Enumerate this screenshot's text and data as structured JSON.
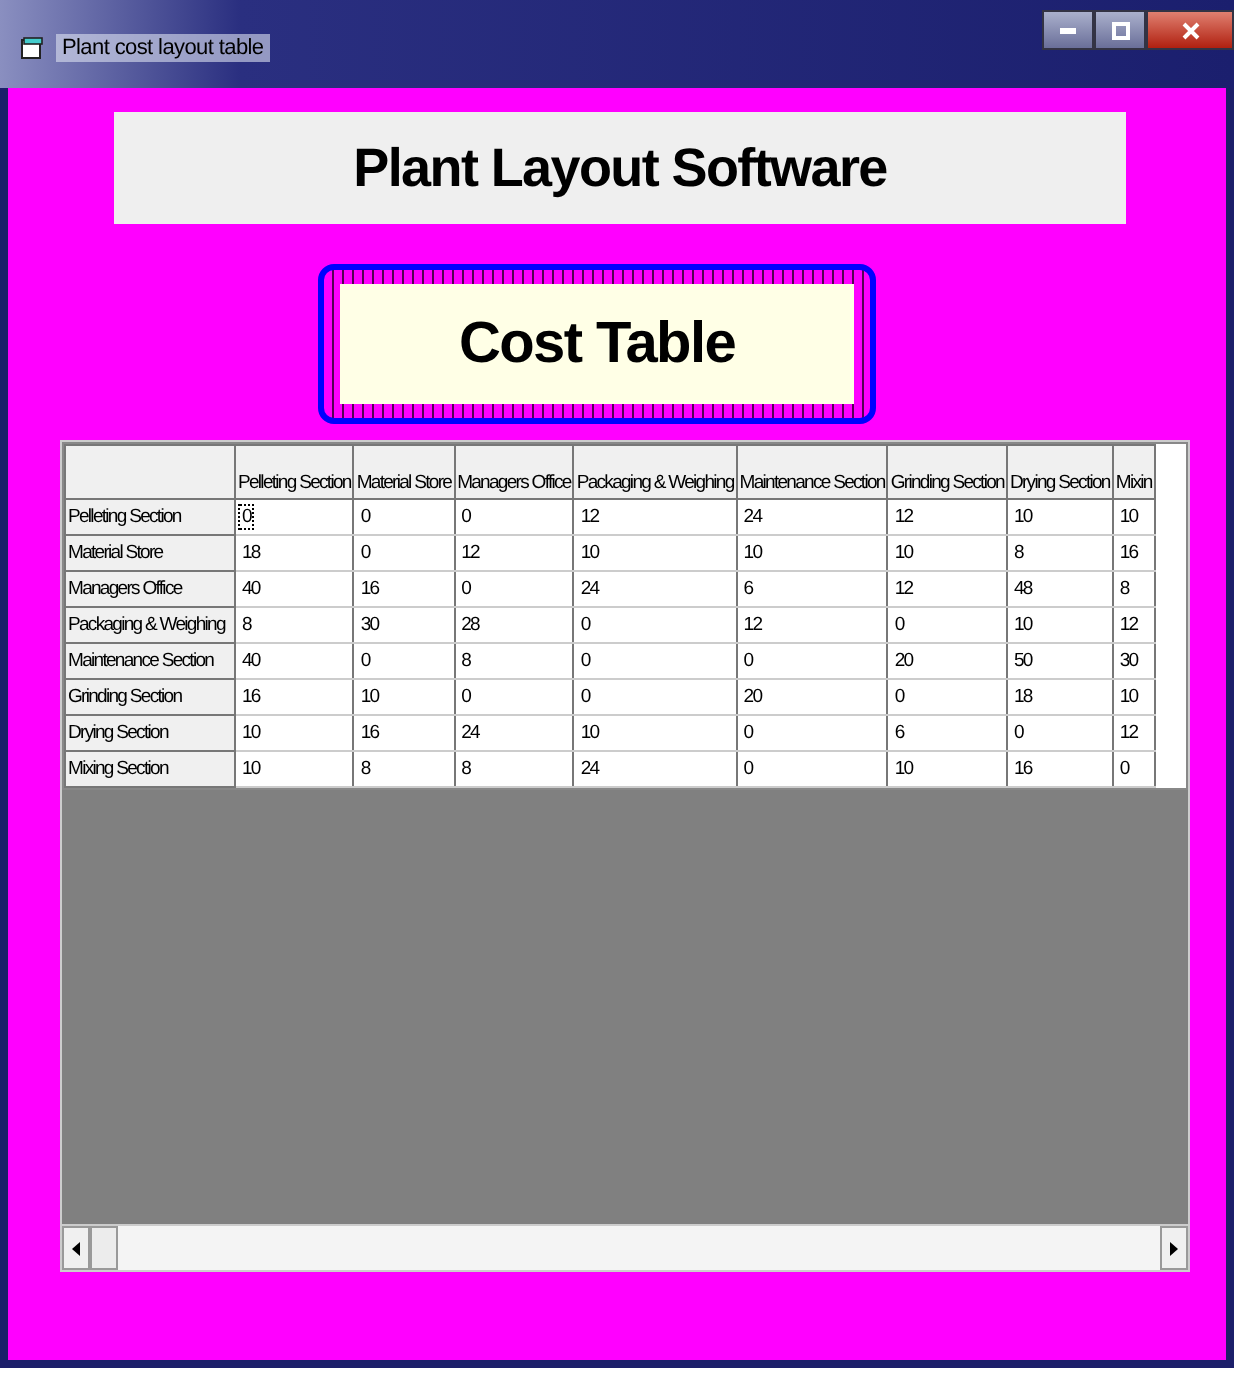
{
  "window": {
    "title": "Plant cost layout table"
  },
  "header": {
    "title": "Plant Layout Software"
  },
  "cost_button": {
    "label": "Cost Table"
  },
  "table": {
    "columns": [
      "Pelleting Section",
      "Material Store",
      "Managers Office",
      "Packaging & Weighing",
      "Maintenance Section",
      "Grinding Section",
      "Drying Section",
      "Mixin"
    ],
    "rows": [
      {
        "label": "Pelleting Section",
        "cells": [
          {
            "text": "0",
            "selected": true
          },
          {
            "text": "0",
            "selected": false
          },
          {
            "text": "0",
            "selected": false
          },
          {
            "text": "12",
            "selected": false
          },
          {
            "text": "24",
            "selected": false
          },
          {
            "text": "12",
            "selected": false
          },
          {
            "text": "10",
            "selected": false
          },
          {
            "text": "10",
            "selected": false
          }
        ]
      },
      {
        "label": "Material Store",
        "cells": [
          {
            "text": "18",
            "selected": false
          },
          {
            "text": "0",
            "selected": false
          },
          {
            "text": "12",
            "selected": false
          },
          {
            "text": "10",
            "selected": false
          },
          {
            "text": "10",
            "selected": false
          },
          {
            "text": "10",
            "selected": false
          },
          {
            "text": "8",
            "selected": false
          },
          {
            "text": "16",
            "selected": false
          }
        ]
      },
      {
        "label": "Managers Office",
        "cells": [
          {
            "text": "40",
            "selected": false
          },
          {
            "text": "16",
            "selected": false
          },
          {
            "text": "0",
            "selected": false
          },
          {
            "text": "24",
            "selected": false
          },
          {
            "text": "6",
            "selected": false
          },
          {
            "text": "12",
            "selected": false
          },
          {
            "text": "48",
            "selected": false
          },
          {
            "text": "8",
            "selected": false
          }
        ]
      },
      {
        "label": "Packaging & Weighing",
        "cells": [
          {
            "text": "8",
            "selected": false
          },
          {
            "text": "30",
            "selected": false
          },
          {
            "text": "28",
            "selected": false
          },
          {
            "text": "0",
            "selected": false
          },
          {
            "text": "12",
            "selected": false
          },
          {
            "text": "0",
            "selected": false
          },
          {
            "text": "10",
            "selected": false
          },
          {
            "text": "12",
            "selected": false
          }
        ]
      },
      {
        "label": "Maintenance Section",
        "cells": [
          {
            "text": "40",
            "selected": false
          },
          {
            "text": "0",
            "selected": false
          },
          {
            "text": "8",
            "selected": false
          },
          {
            "text": "0",
            "selected": false
          },
          {
            "text": "0",
            "selected": false
          },
          {
            "text": "20",
            "selected": false
          },
          {
            "text": "50",
            "selected": false
          },
          {
            "text": "30",
            "selected": false
          }
        ]
      },
      {
        "label": "Grinding Section",
        "cells": [
          {
            "text": "16",
            "selected": false
          },
          {
            "text": "10",
            "selected": false
          },
          {
            "text": "0",
            "selected": false
          },
          {
            "text": "0",
            "selected": false
          },
          {
            "text": "20",
            "selected": false
          },
          {
            "text": "0",
            "selected": false
          },
          {
            "text": "18",
            "selected": false
          },
          {
            "text": "10",
            "selected": false
          }
        ]
      },
      {
        "label": "Drying Section",
        "cells": [
          {
            "text": "10",
            "selected": false
          },
          {
            "text": "16",
            "selected": false
          },
          {
            "text": "24",
            "selected": false
          },
          {
            "text": "10",
            "selected": false
          },
          {
            "text": "0",
            "selected": false
          },
          {
            "text": "6",
            "selected": false
          },
          {
            "text": "0",
            "selected": false
          },
          {
            "text": "12",
            "selected": false
          }
        ]
      },
      {
        "label": "Mixing Section",
        "cells": [
          {
            "text": "10",
            "selected": false
          },
          {
            "text": "8",
            "selected": false
          },
          {
            "text": "8",
            "selected": false
          },
          {
            "text": "24",
            "selected": false
          },
          {
            "text": "0",
            "selected": false
          },
          {
            "text": "10",
            "selected": false
          },
          {
            "text": "16",
            "selected": false
          },
          {
            "text": "0",
            "selected": false
          }
        ]
      }
    ]
  }
}
